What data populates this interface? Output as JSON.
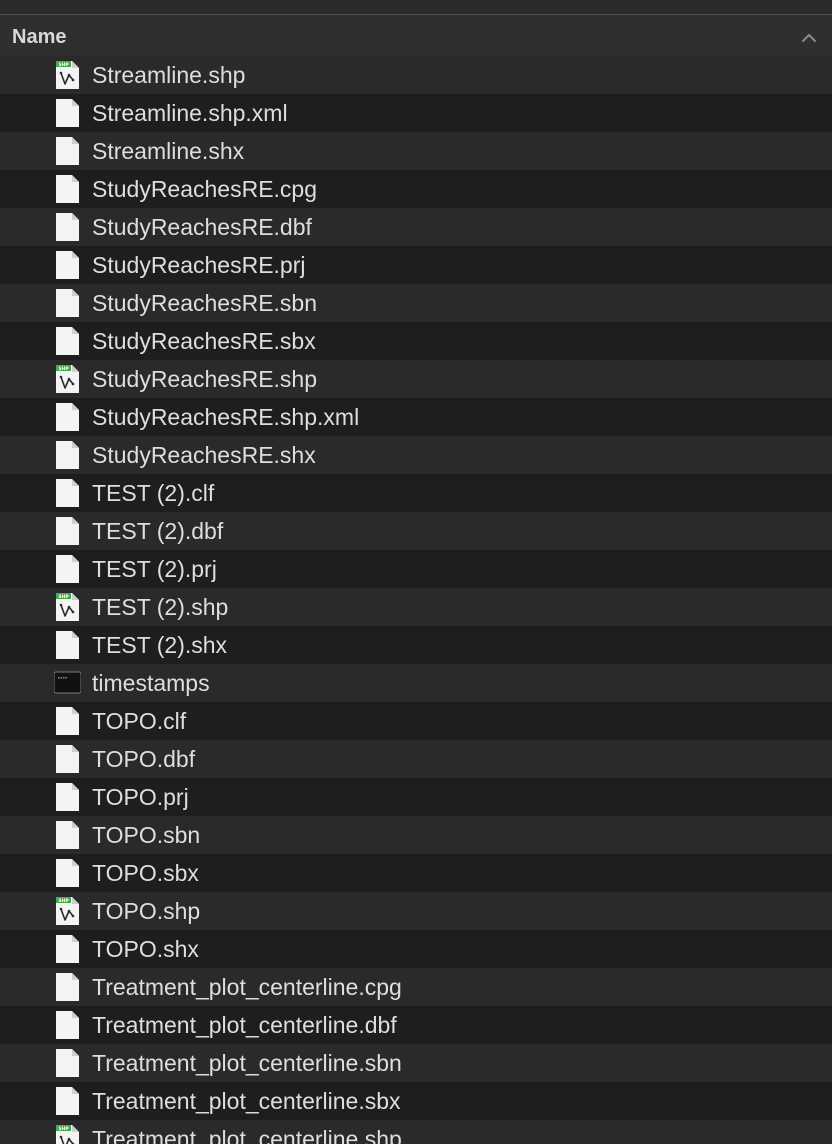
{
  "header": {
    "name_label": "Name",
    "sort_icon": "chevron-up-icon"
  },
  "files": [
    {
      "name": "Streamline.shp",
      "icon": "shp-icon"
    },
    {
      "name": "Streamline.shp.xml",
      "icon": "document-icon"
    },
    {
      "name": "Streamline.shx",
      "icon": "document-icon"
    },
    {
      "name": "StudyReachesRE.cpg",
      "icon": "document-icon"
    },
    {
      "name": "StudyReachesRE.dbf",
      "icon": "document-icon"
    },
    {
      "name": "StudyReachesRE.prj",
      "icon": "document-icon"
    },
    {
      "name": "StudyReachesRE.sbn",
      "icon": "document-icon"
    },
    {
      "name": "StudyReachesRE.sbx",
      "icon": "document-icon"
    },
    {
      "name": "StudyReachesRE.shp",
      "icon": "shp-icon"
    },
    {
      "name": "StudyReachesRE.shp.xml",
      "icon": "document-icon"
    },
    {
      "name": "StudyReachesRE.shx",
      "icon": "document-icon"
    },
    {
      "name": "TEST (2).clf",
      "icon": "document-icon"
    },
    {
      "name": "TEST (2).dbf",
      "icon": "document-icon"
    },
    {
      "name": "TEST (2).prj",
      "icon": "document-icon"
    },
    {
      "name": "TEST (2).shp",
      "icon": "shp-icon"
    },
    {
      "name": "TEST (2).shx",
      "icon": "document-icon"
    },
    {
      "name": "timestamps",
      "icon": "terminal-icon"
    },
    {
      "name": "TOPO.clf",
      "icon": "document-icon"
    },
    {
      "name": "TOPO.dbf",
      "icon": "document-icon"
    },
    {
      "name": "TOPO.prj",
      "icon": "document-icon"
    },
    {
      "name": "TOPO.sbn",
      "icon": "document-icon"
    },
    {
      "name": "TOPO.sbx",
      "icon": "document-icon"
    },
    {
      "name": "TOPO.shp",
      "icon": "shp-icon"
    },
    {
      "name": "TOPO.shx",
      "icon": "document-icon"
    },
    {
      "name": "Treatment_plot_centerline.cpg",
      "icon": "document-icon"
    },
    {
      "name": "Treatment_plot_centerline.dbf",
      "icon": "document-icon"
    },
    {
      "name": "Treatment_plot_centerline.sbn",
      "icon": "document-icon"
    },
    {
      "name": "Treatment_plot_centerline.sbx",
      "icon": "document-icon"
    },
    {
      "name": "Treatment_plot_centerline.shp",
      "icon": "shp-icon"
    }
  ],
  "colors": {
    "background": "#1e1e1e",
    "row_alt": "#2a2a2a",
    "header_bg": "#2f2f2f",
    "text": "#dedede",
    "shp_badge": "#3fae49"
  }
}
